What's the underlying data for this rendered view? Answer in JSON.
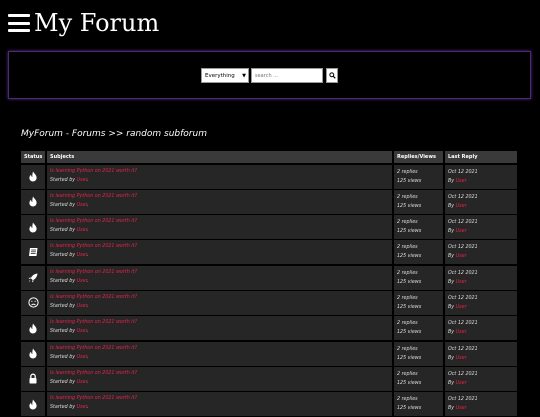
{
  "header": {
    "title": "My Forum"
  },
  "search": {
    "scope": "Everything",
    "placeholder": "search ..."
  },
  "breadcrumb": "MyForum - Forums >> random subforum",
  "columns": {
    "status": "Status",
    "subjects": "Subjects",
    "replies": "Replies/Views",
    "last": "Last Reply"
  },
  "topics": [
    {
      "icon": "fire-icon",
      "subject": "Is learning Python on 2021 worth it?",
      "started": "Started by",
      "user": "User",
      "replies": "2 replies",
      "views": "125 views",
      "date": "Oct 12 2021",
      "by": "By",
      "last_user": "User"
    },
    {
      "icon": "fire-icon",
      "subject": "Is learning Python on 2021 worth it?",
      "started": "Started by",
      "user": "User",
      "replies": "2 replies",
      "views": "125 views",
      "date": "Oct 12 2021",
      "by": "By",
      "last_user": "User"
    },
    {
      "icon": "fire-icon",
      "subject": "Is learning Python on 2021 worth it?",
      "started": "Started by",
      "user": "User",
      "replies": "2 replies",
      "views": "125 views",
      "date": "Oct 12 2021",
      "by": "By",
      "last_user": "User"
    },
    {
      "icon": "book-icon",
      "subject": "Is learning Python on 2021 worth it?",
      "started": "Started by",
      "user": "User",
      "replies": "2 replies",
      "views": "125 views",
      "date": "Oct 12 2021",
      "by": "By",
      "last_user": "User"
    },
    {
      "icon": "rocket-icon",
      "subject": "Is learning Python on 2021 worth it?",
      "started": "Started by",
      "user": "User",
      "replies": "2 replies",
      "views": "125 views",
      "date": "Oct 12 2021",
      "by": "By",
      "last_user": "User"
    },
    {
      "icon": "sad-face-icon",
      "subject": "Is learning Python on 2021 worth it?",
      "started": "Started by",
      "user": "User",
      "replies": "2 replies",
      "views": "125 views",
      "date": "Oct 12 2021",
      "by": "By",
      "last_user": "User"
    },
    {
      "icon": "fire-icon",
      "subject": "Is learning Python on 2021 worth it?",
      "started": "Started by",
      "user": "User",
      "replies": "2 replies",
      "views": "125 views",
      "date": "Oct 12 2021",
      "by": "By",
      "last_user": "User"
    },
    {
      "icon": "fire-icon",
      "subject": "Is learning Python on 2021 worth it?",
      "started": "Started by",
      "user": "User",
      "replies": "2 replies",
      "views": "125 views",
      "date": "Oct 12 2021",
      "by": "By",
      "last_user": "User"
    },
    {
      "icon": "lock-icon",
      "subject": "Is learning Python on 2021 worth it?",
      "started": "Started by",
      "user": "User",
      "replies": "2 replies",
      "views": "125 views",
      "date": "Oct 12 2021",
      "by": "By",
      "last_user": "User"
    },
    {
      "icon": "fire-icon",
      "subject": "Is learning Python on 2021 worth it?",
      "started": "Started by",
      "user": "User",
      "replies": "2 replies",
      "views": "125 views",
      "date": "Oct 12 2021",
      "by": "By",
      "last_user": "User"
    }
  ],
  "colors": {
    "accent": "#e8234a",
    "panel_border": "#4d2a78",
    "row_bg": "#262626"
  }
}
